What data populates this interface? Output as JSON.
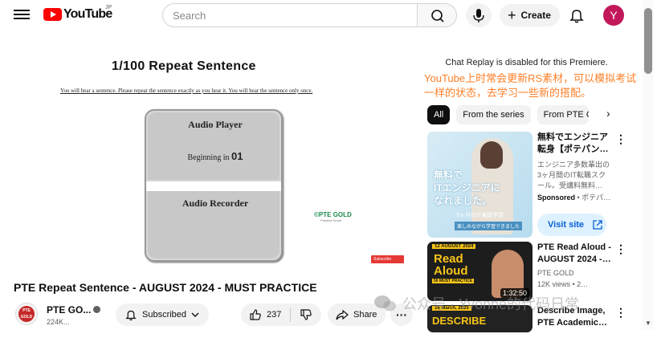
{
  "header": {
    "logo_text": "YouTube",
    "logo_region": "JP",
    "search_placeholder": "Search",
    "create_label": "Create",
    "avatar_letter": "Y"
  },
  "player": {
    "slide_title": "1/100   Repeat Sentence",
    "instructions": "You will hear a sentence. Please repeat the sentence exactly as you hear it. You will hear the sentence only once.",
    "audio_player_label": "Audio Player",
    "countdown_prefix": "Beginning in",
    "countdown_value": "01",
    "audio_recorder_label": "Audio Recorder",
    "watermark_brand": "PTE GOLD",
    "watermark_tagline": "Practice Smart",
    "subscribe_watermark": "Subscribe"
  },
  "video": {
    "title": "PTE Repeat Sentence - AUGUST 2024 - MUST PRACTICE",
    "channel_name": "PTE GO...",
    "channel_avatar_text": "PTE GOLD",
    "subscribers": "224K...",
    "subscribed_label": "Subscribed",
    "like_count": "237",
    "share_label": "Share"
  },
  "sidebar": {
    "chat_note": "Chat Replay is disabled for this Premiere.",
    "overlay_note": "YouTube上时常会更新RS素材，可以模拟考试一样的状态，去学习一些新的搭配。",
    "chips": [
      "All",
      "From the series",
      "From PTE G"
    ],
    "recommendations": [
      {
        "title": "無料でエンジニア転身【ポテパン…",
        "description": "エンジニア多数輩出の3ヶ月間のIT転職スクール。受講料無料…",
        "sponsored": "Sponsored",
        "advertiser": " • ポテパ…",
        "cta": "Visit site",
        "thumb_text_1": "無料で",
        "thumb_text_2": "ITエンジニアに",
        "thumb_text_3": "なれました。",
        "thumb_sub_1": "3ヶ月のIT実践学習",
        "thumb_sub_2": "楽しみながら学習できました"
      },
      {
        "title": "PTE Read Aloud - AUGUST 2024 -…",
        "channel": "PTE GOLD",
        "meta": "12K views • 2…",
        "duration": "1:32:50",
        "thumb_date": "12 AUGUST 2024",
        "thumb_title_1": "Read",
        "thumb_title_2": "Aloud",
        "thumb_must": "50 MUST PRACTICE"
      },
      {
        "title": "Describe Image, PTE Academic…",
        "thumb_date": "16 March, 2025",
        "thumb_title": "DESCRIBE"
      }
    ]
  },
  "overlay_watermark": "公众号 · Yvonne的代码日常"
}
